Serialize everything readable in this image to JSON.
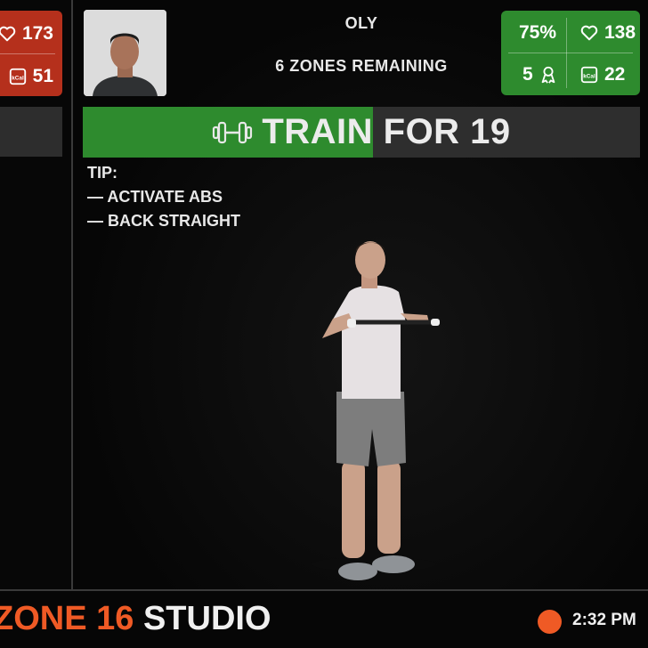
{
  "left_tile": {
    "heart_rate": "173",
    "calories": "51",
    "color": "#b5301c",
    "icons": {
      "heart": "heart-icon",
      "calories": "kcal-icon"
    }
  },
  "main_tile": {
    "user_name": "OLY",
    "zones_remaining": "6 ZONES REMAINING",
    "stats": {
      "effort_percent": "75%",
      "heart_rate": "138",
      "medals": "5",
      "calories": "22",
      "color": "#2e8b2e"
    },
    "train_bar": {
      "label": "TRAIN FOR 19",
      "progress": 0.52,
      "fill_color": "#2e8b2e",
      "icon": "dumbbell-icon"
    },
    "tip": {
      "title": "TIP:",
      "lines": [
        "— ACTIVATE ABS",
        "— BACK STRAIGHT"
      ]
    }
  },
  "bottom_bar": {
    "zone_text": "ZONE 16",
    "studio_text": " STUDIO",
    "time": "2:32 PM",
    "accent_color": "#ef5a25"
  }
}
